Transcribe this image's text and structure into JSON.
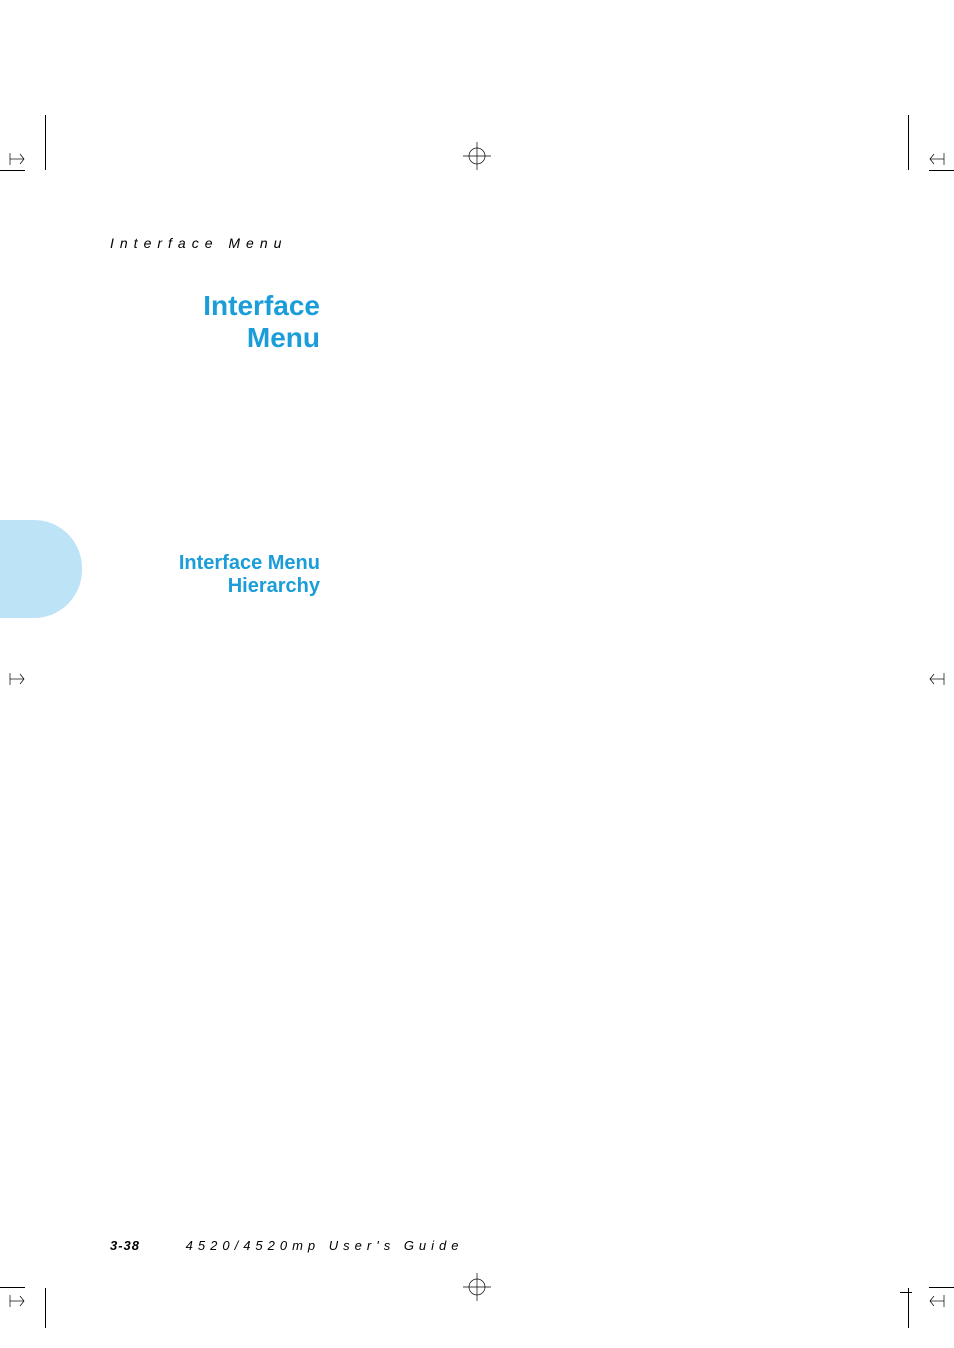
{
  "runningHeader": "Interface Menu",
  "headingMain": {
    "line1": "Interface",
    "line2": "Menu"
  },
  "headingSub": {
    "line1": "Interface Menu",
    "line2": "Hierarchy"
  },
  "footer": {
    "pageNumber": "3-38",
    "guideTitle": "4520/4520mp User's Guide"
  },
  "colors": {
    "headingBlue": "#1a9dd9",
    "tabBlue": "#bde3f7"
  }
}
